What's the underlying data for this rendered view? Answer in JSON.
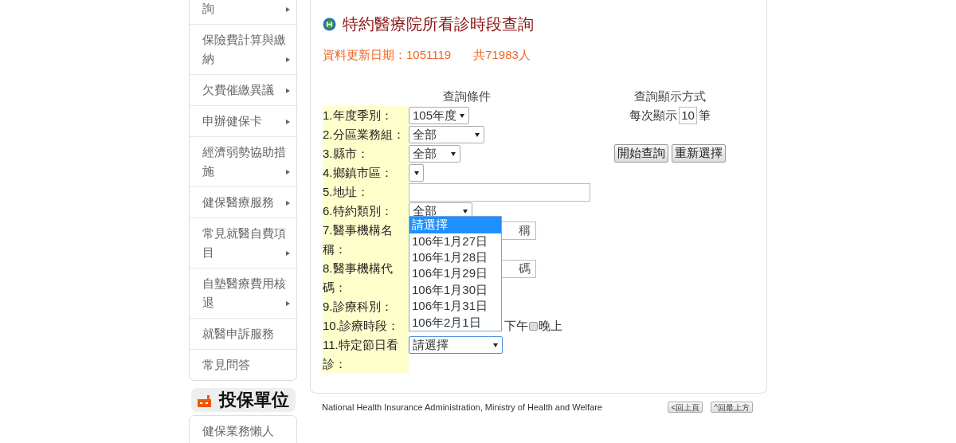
{
  "sidebar": {
    "items": [
      {
        "label": "詢",
        "arrow": true
      },
      {
        "label": "保險費計算與繳納",
        "arrow": true
      },
      {
        "label": "欠費催繳異議",
        "arrow": true
      },
      {
        "label": "申辦健保卡",
        "arrow": true
      },
      {
        "label": "經濟弱勢協助措施",
        "arrow": true
      },
      {
        "label": "健保醫療服務",
        "arrow": true
      },
      {
        "label": "常見就醫自費項目",
        "arrow": true
      },
      {
        "label": "自墊醫療費用核退",
        "arrow": true
      },
      {
        "label": "就醫申訴服務",
        "arrow": false
      },
      {
        "label": "常見問答",
        "arrow": false
      }
    ],
    "section": {
      "title": "投保單位"
    },
    "section_items": [
      {
        "label": "健保業務懶人"
      }
    ]
  },
  "page": {
    "title": "特約醫療院所看診時段查詢",
    "update": "資料更新日期：1051119",
    "total": "共71983人"
  },
  "form": {
    "criteria_heading": "查詢條件",
    "rows": [
      {
        "label": "1.年度季別：",
        "kind": "select",
        "value": "105年度"
      },
      {
        "label": "2.分區業務組：",
        "kind": "select",
        "value": "全部"
      },
      {
        "label": "3.縣市：",
        "kind": "select",
        "value": "全部"
      },
      {
        "label": "4.鄉鎮市區：",
        "kind": "select"
      },
      {
        "label": "5.地址：",
        "kind": "input"
      },
      {
        "label": "6.特約類別：",
        "kind": "select",
        "value": "全部"
      },
      {
        "label": "7.醫事機構名稱：",
        "kind": "input",
        "value": "稱"
      },
      {
        "label": "8.醫事機構代碼：",
        "kind": "input",
        "value": "碼"
      },
      {
        "label": "9.診療科別：",
        "kind": "none"
      },
      {
        "label": "10.診療時段：",
        "kind": "checks",
        "items": [
          {
            "label": "下午"
          },
          {
            "label": "晚上",
            "checked": false
          }
        ]
      },
      {
        "label": "11.特定節日看診：",
        "kind": "select",
        "value": "請選擇",
        "focused": true
      }
    ],
    "dropdown": {
      "options": [
        {
          "label": "請選擇",
          "selected": true
        },
        {
          "label": "106年1月27日",
          "selected": false
        },
        {
          "label": "106年1月28日",
          "selected": false
        },
        {
          "label": "106年1月29日",
          "selected": false
        },
        {
          "label": "106年1月30日",
          "selected": false
        },
        {
          "label": "106年1月31日",
          "selected": false
        },
        {
          "label": "106年2月1日",
          "selected": false
        }
      ]
    }
  },
  "display": {
    "heading": "查詢顯示方式",
    "prefix": "每次顯示",
    "count": "10",
    "suffix": "筆",
    "buttons": [
      "開始查詢",
      "重新選擇"
    ]
  },
  "footer": {
    "text": "National Health Insurance Administration, Ministry of Health and Welfare",
    "buttons": [
      "<回上頁",
      "^回最上方"
    ]
  }
}
